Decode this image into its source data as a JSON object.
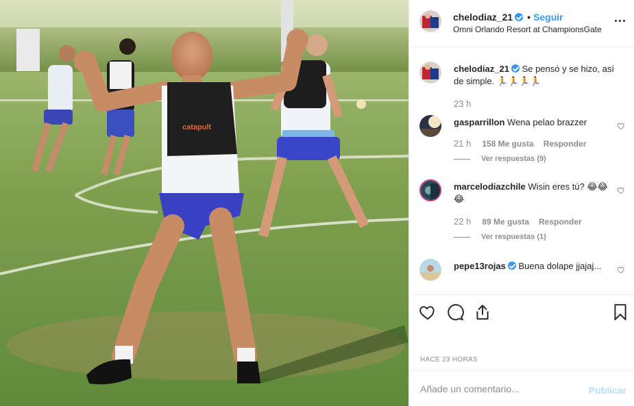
{
  "post": {
    "username": "chelodiaz_21",
    "follow_label": "Seguir",
    "separator": "•",
    "location": "Omni Orlando Resort at ChampionsGate",
    "more_icon": "more-options-icon",
    "photo_alt": "Jugadores entrenando en cancha de fútbol",
    "shirt_text": "catapult"
  },
  "caption": {
    "username": "chelodiaz_21",
    "text": "Se pensó y se hizo, así de simple. 🏃🏃🏃🏃",
    "time": "23 h"
  },
  "comments": [
    {
      "username": "gasparrillon",
      "text": "Wena pelao brazzer",
      "time": "21 h",
      "likes": "158 Me gusta",
      "reply": "Responder",
      "view_replies": "Ver respuestas (9)"
    },
    {
      "username": "marcelodiazchile",
      "text": "Wisin eres tú? 😂😂😂",
      "time": "22 h",
      "likes": "89 Me gusta",
      "reply": "Responder",
      "view_replies": "Ver respuestas (1)"
    },
    {
      "username": "pepe13rojas",
      "text": "Buena dolape jjajaj...",
      "time": "",
      "likes": "",
      "reply": "",
      "view_replies": ""
    }
  ],
  "actions": {
    "like_icon": "heart-icon",
    "comment_icon": "comment-icon",
    "share_icon": "share-icon",
    "save_icon": "bookmark-icon"
  },
  "timestamp": "HACE 23 HORAS",
  "add_comment": {
    "placeholder": "Añade un comentario...",
    "publish_label": "Publicar"
  },
  "colors": {
    "accent": "#3897f0",
    "publish_disabled": "#b2dffc",
    "muted": "#8e8e8e",
    "text": "#262626",
    "divider": "#efefef"
  }
}
